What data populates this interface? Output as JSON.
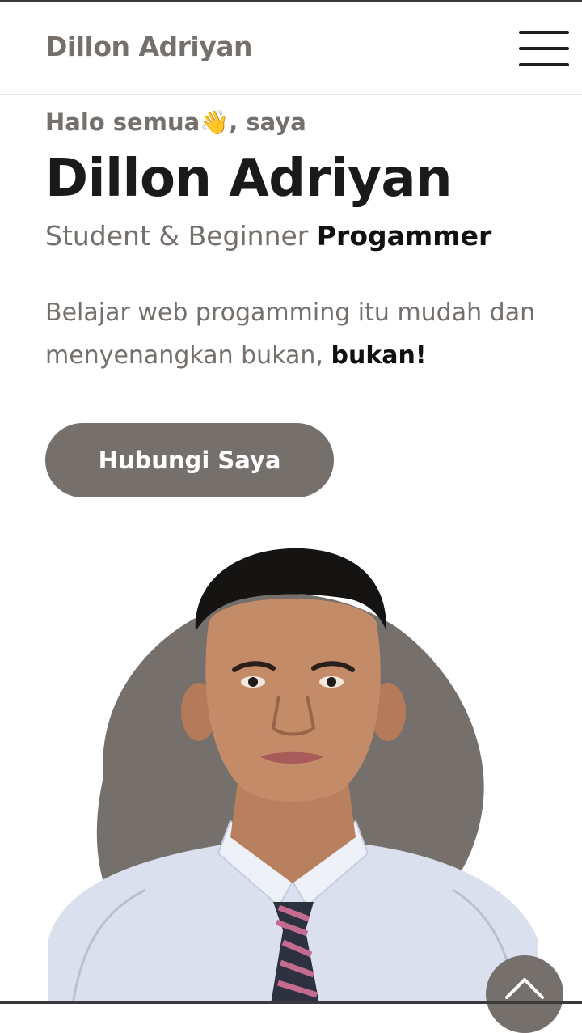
{
  "nav": {
    "brand": "Dillon Adriyan",
    "menu_icon": "hamburger-menu-icon"
  },
  "hero": {
    "greeting_before": "Halo semua",
    "greeting_emoji": "👋",
    "greeting_after": ", saya",
    "name": "Dillon Adriyan",
    "role_prefix": "Student & Beginner ",
    "role_highlight": "Progammer",
    "tagline_main": "Belajar web progamming itu mudah dan menyenangkan bukan, ",
    "tagline_highlight": "bukan!",
    "cta_label": "Hubungi Saya"
  },
  "portrait": {
    "icon": "profile-photo"
  },
  "scroll_top": {
    "icon": "chevron-up-icon"
  },
  "colors": {
    "accent": "#75706c",
    "heading": "#1b1a19",
    "background": "#ffffff"
  }
}
